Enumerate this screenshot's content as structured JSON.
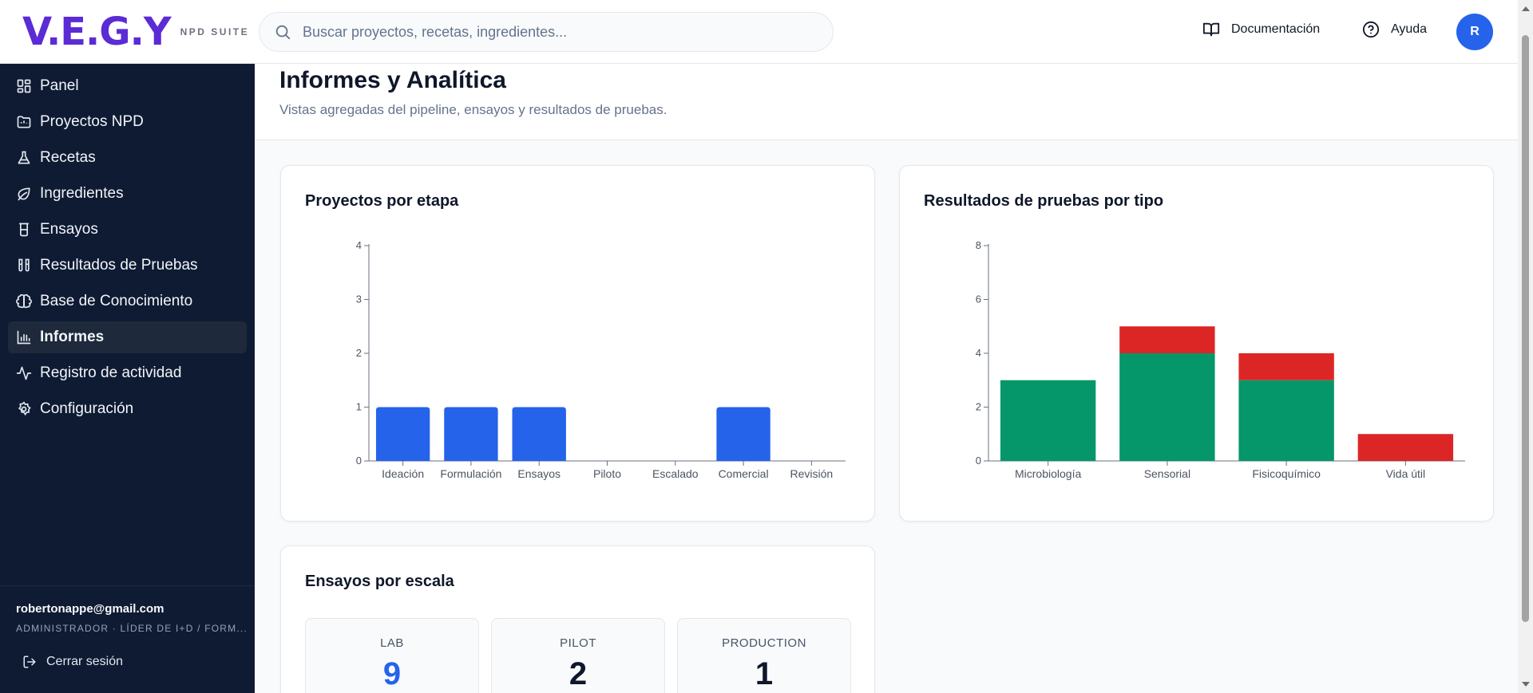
{
  "header": {
    "logo_text": "V.E.G.Y",
    "logo_sub": "NPD SUITE",
    "search_placeholder": "Buscar proyectos, recetas, ingredientes...",
    "docs_label": "Documentación",
    "help_label": "Ayuda",
    "avatar_initial": "R"
  },
  "sidebar": {
    "items": [
      {
        "label": "Panel",
        "icon": "grid-icon"
      },
      {
        "label": "Proyectos NPD",
        "icon": "folder-icon"
      },
      {
        "label": "Recetas",
        "icon": "flask-icon"
      },
      {
        "label": "Ingredientes",
        "icon": "leaf-icon"
      },
      {
        "label": "Ensayos",
        "icon": "beaker-icon"
      },
      {
        "label": "Resultados de Pruebas",
        "icon": "test-tubes-icon"
      },
      {
        "label": "Base de Conocimiento",
        "icon": "brain-icon"
      },
      {
        "label": "Informes",
        "icon": "bar-chart-icon"
      },
      {
        "label": "Registro de actividad",
        "icon": "activity-icon"
      },
      {
        "label": "Configuración",
        "icon": "gear-icon"
      }
    ],
    "active_index": 7,
    "user_email": "robertonappe@gmail.com",
    "user_role": "ADMINISTRADOR · LÍDER DE I+D / FORM...",
    "logout_label": "Cerrar sesión"
  },
  "page": {
    "title": "Informes y Analítica",
    "subtitle": "Vistas agregadas del pipeline, ensayos y resultados de pruebas."
  },
  "chart_data": [
    {
      "type": "bar",
      "title": "Proyectos por etapa",
      "categories": [
        "Ideación",
        "Formulación",
        "Ensayos",
        "Piloto",
        "Escalado",
        "Comercial",
        "Revisión"
      ],
      "values": [
        1,
        1,
        1,
        0,
        0,
        1,
        0
      ],
      "ylim": [
        0,
        4
      ],
      "yticks": [
        0,
        1,
        2,
        3,
        4
      ],
      "color": "#2563eb",
      "grid": false
    },
    {
      "type": "bar",
      "stacked": true,
      "title": "Resultados de pruebas por tipo",
      "categories": [
        "Microbiología",
        "Sensorial",
        "Fisicoquímico",
        "Vida útil"
      ],
      "series": [
        {
          "values": [
            3,
            4,
            3,
            0
          ],
          "color": "#059669"
        },
        {
          "values": [
            0,
            1,
            1,
            1
          ],
          "color": "#dc2626"
        }
      ],
      "ylim": [
        0,
        8
      ],
      "yticks": [
        0,
        2,
        4,
        6,
        8
      ],
      "grid": false
    }
  ],
  "scales": {
    "title": "Ensayos por escala",
    "items": [
      {
        "label": "LAB",
        "value": "9",
        "color": "#2563eb"
      },
      {
        "label": "PILOT",
        "value": "2",
        "color": "#0f172a"
      },
      {
        "label": "PRODUCTION",
        "value": "1",
        "color": "#0f172a"
      }
    ]
  }
}
